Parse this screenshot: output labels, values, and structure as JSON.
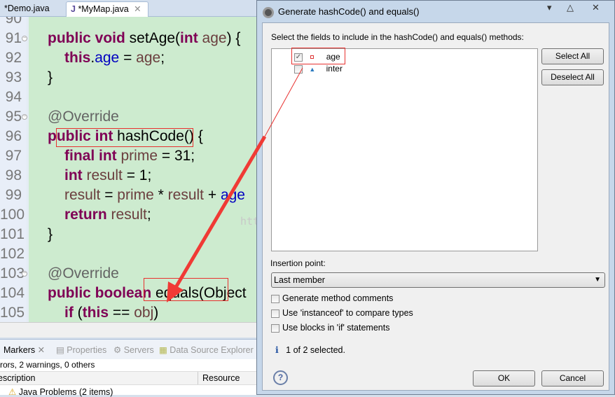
{
  "editor_tabs": [
    {
      "label": "*Demo.java"
    },
    {
      "label": "*MyMap.java",
      "active": true
    }
  ],
  "code_lines": [
    {
      "n": "90",
      "tokens": []
    },
    {
      "n": "91",
      "fold": true,
      "tokens": [
        {
          "t": "public void ",
          "c": "kw"
        },
        {
          "t": "setAge(",
          "c": "pl"
        },
        {
          "t": "int ",
          "c": "kw"
        },
        {
          "t": "age",
          "c": "var"
        },
        {
          "t": ") {",
          "c": "pl"
        }
      ]
    },
    {
      "n": "92",
      "indent": 1,
      "tokens": [
        {
          "t": "this",
          "c": "kw"
        },
        {
          "t": ".",
          "c": "pl"
        },
        {
          "t": "age",
          "c": "fld"
        },
        {
          "t": " = ",
          "c": "pl"
        },
        {
          "t": "age",
          "c": "var"
        },
        {
          "t": ";",
          "c": "pl"
        }
      ]
    },
    {
      "n": "93",
      "tokens": [
        {
          "t": "}",
          "c": "pl"
        }
      ]
    },
    {
      "n": "94",
      "tokens": []
    },
    {
      "n": "95",
      "fold": true,
      "tokens": [
        {
          "t": "@Override",
          "c": "ann"
        }
      ]
    },
    {
      "n": "96",
      "tokens": [
        {
          "t": "public int ",
          "c": "kw"
        },
        {
          "t": "hashCode() {",
          "c": "pl"
        }
      ]
    },
    {
      "n": "97",
      "indent": 1,
      "tokens": [
        {
          "t": "final int ",
          "c": "kw"
        },
        {
          "t": "prime",
          "c": "var"
        },
        {
          "t": " = 31;",
          "c": "pl"
        }
      ]
    },
    {
      "n": "98",
      "indent": 1,
      "tokens": [
        {
          "t": "int ",
          "c": "kw"
        },
        {
          "t": "result",
          "c": "var"
        },
        {
          "t": " = 1;",
          "c": "pl"
        }
      ]
    },
    {
      "n": "99",
      "indent": 1,
      "tokens": [
        {
          "t": "result",
          "c": "var"
        },
        {
          "t": " = ",
          "c": "pl"
        },
        {
          "t": "prime",
          "c": "var"
        },
        {
          "t": " * ",
          "c": "pl"
        },
        {
          "t": "result",
          "c": "var"
        },
        {
          "t": " + ",
          "c": "pl"
        },
        {
          "t": "age",
          "c": "fld"
        }
      ]
    },
    {
      "n": "100",
      "indent": 1,
      "tokens": [
        {
          "t": "return ",
          "c": "kw"
        },
        {
          "t": "result",
          "c": "var"
        },
        {
          "t": ";",
          "c": "pl"
        }
      ]
    },
    {
      "n": "101",
      "tokens": [
        {
          "t": "}",
          "c": "pl"
        }
      ]
    },
    {
      "n": "102",
      "tokens": []
    },
    {
      "n": "103",
      "fold": true,
      "tokens": [
        {
          "t": "@Override",
          "c": "ann"
        }
      ]
    },
    {
      "n": "104",
      "tokens": [
        {
          "t": "public boolean ",
          "c": "kw"
        },
        {
          "t": "equals(Object",
          "c": "pl"
        }
      ]
    },
    {
      "n": "105",
      "indent": 1,
      "tokens": [
        {
          "t": "if ",
          "c": "kw"
        },
        {
          "t": "(",
          "c": "pl"
        },
        {
          "t": "this",
          "c": "kw"
        },
        {
          "t": " == ",
          "c": "pl"
        },
        {
          "t": "obj",
          "c": "var"
        },
        {
          "t": ")",
          "c": "pl"
        }
      ]
    }
  ],
  "watermark": "http://blog.csdn.net/",
  "bottom_panel": {
    "tabs": [
      "Markers",
      "Properties",
      "Servers",
      "Data Source Explorer"
    ],
    "summary": "rrors, 2 warnings, 0 others",
    "columns": [
      "escription",
      "Resource"
    ],
    "rows": [
      "Java Problems (2 items)"
    ]
  },
  "dialog": {
    "title": "Generate hashCode() and equals()",
    "prompt": "Select the fields to include in the hashCode() and equals() methods:",
    "fields": [
      {
        "name": "age",
        "checked": true,
        "icon": "private-field-icon"
      },
      {
        "name": "inter",
        "checked": false,
        "icon": "default-field-icon"
      }
    ],
    "select_all": "Select All",
    "deselect_all": "Deselect All",
    "insertion_label": "Insertion point:",
    "insertion_value": "Last member",
    "options": [
      {
        "label": "Generate method comments",
        "checked": false
      },
      {
        "label": "Use 'instanceof' to compare types",
        "checked": false
      },
      {
        "label": "Use blocks in 'if' statements",
        "checked": false
      }
    ],
    "status": "1 of 2 selected.",
    "ok": "OK",
    "cancel": "Cancel"
  },
  "annotation_color": "#e8312f"
}
